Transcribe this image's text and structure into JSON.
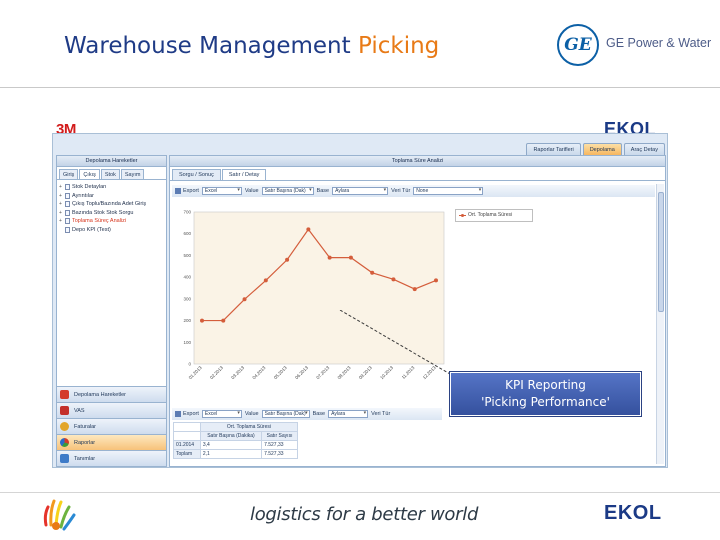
{
  "slide": {
    "title_main": "Warehouse Management",
    "title_highlight": "Picking",
    "partner_name": "GE Power & Water",
    "partner_logo_text": "GE",
    "client_logo": "3M",
    "company_logo": "EKOL",
    "slogan": "logistics for a better world"
  },
  "app": {
    "top_tabs": [
      "Raporlar Tarifleri",
      "Depolama",
      "Araç Detay"
    ],
    "left_panel": {
      "title": "Depolama Hareketler",
      "tabs": [
        "Giriş",
        "Çıkış",
        "Stok",
        "Sayım"
      ],
      "tree": [
        "Stok Detayları",
        "Ayrıntılar",
        "Çıkış Toplu/Bazında Adet Giriş",
        "Bazında Stok Stok Sorgu",
        "Toplama Süreç Analizi",
        "Depo KPI (Test)"
      ],
      "active_tree_index": 4,
      "nav": [
        "Depolama Hareketler",
        "VAS",
        "Faturalar",
        "Raporlar",
        "Tanımlar"
      ],
      "active_nav_index": 3
    },
    "content": {
      "title": "Toplama Süre Analizi",
      "tabs": [
        "Sorgu / Sonuç",
        "Satır / Detay"
      ],
      "active_tab_index": 1,
      "toolbar": {
        "export_label": "Export",
        "export_value": "Excel",
        "value_label": "Value",
        "value_value": "Satır Başına (Dak)",
        "base_label": "Base",
        "base_value": "Aylara",
        "group_label": "Veri Tür",
        "group_value": "None"
      },
      "toolbar2": {
        "export_label": "Export",
        "export_value": "Excel",
        "value_label": "Value",
        "value_value": "Satır Başına (Dak)",
        "base_label": "Base",
        "base_value": "Aylara",
        "group_label": "Veri Tür"
      },
      "pivot": {
        "header": "Ort. Toplama Süresi",
        "columns": [
          "Satır Başına (Dakika)",
          "Satır Sayısı"
        ],
        "rows": [
          {
            "label": "01.2014",
            "values": [
              "3,4",
              "7.527,33"
            ]
          },
          {
            "label": "Toplam",
            "values": [
              "2,1",
              "7.527,33"
            ]
          }
        ]
      }
    }
  },
  "callout": {
    "line1": "KPI Reporting",
    "line2": "'Picking Performance'"
  },
  "chart_data": {
    "type": "line",
    "series": [
      {
        "name": "Ort. Toplama Süresi",
        "values": [
          200,
          200,
          298,
          385,
          480,
          620,
          490,
          490,
          420,
          390,
          345,
          385
        ]
      }
    ],
    "categories": [
      "01.2013",
      "02.2013",
      "03.2013",
      "04.2013",
      "05.2013",
      "06.2013",
      "07.2013",
      "08.2013",
      "09.2013",
      "10.2013",
      "11.2013",
      "12.2013"
    ],
    "ylim": [
      0,
      700
    ],
    "yticks": [
      0,
      100,
      200,
      300,
      400,
      500,
      600,
      700
    ],
    "grid": false,
    "legend": "top-right",
    "color": "#d45d3b",
    "plot_bg": "#faf3e6"
  }
}
